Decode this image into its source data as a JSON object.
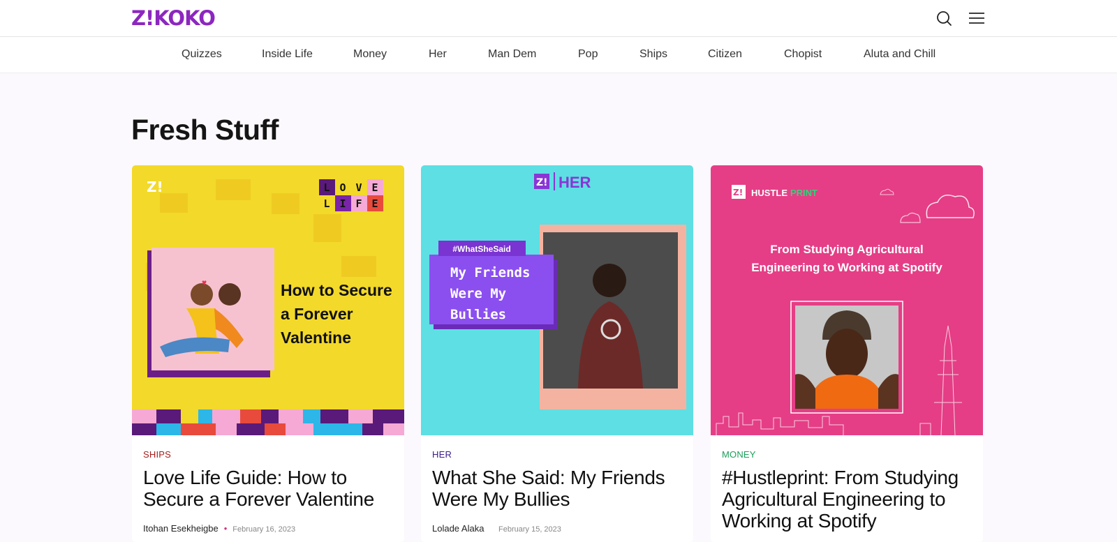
{
  "brand": {
    "logo": "Z!KOKO"
  },
  "header": {
    "search_icon": "search-icon",
    "menu_icon": "hamburger-menu-icon"
  },
  "nav": {
    "items": [
      {
        "label": "Quizzes"
      },
      {
        "label": "Inside Life"
      },
      {
        "label": "Money"
      },
      {
        "label": "Her"
      },
      {
        "label": "Man Dem"
      },
      {
        "label": "Pop"
      },
      {
        "label": "Ships"
      },
      {
        "label": "Citizen"
      },
      {
        "label": "Chopist"
      },
      {
        "label": "Aluta and Chill"
      }
    ]
  },
  "section": {
    "title": "Fresh Stuff"
  },
  "cards": [
    {
      "category": "Ships",
      "category_color": "#a51e1e",
      "title": "Love Life Guide: How to Secure a Forever Valentine",
      "author": "Itohan Esekheigbe",
      "date": "February 16, 2023",
      "image": {
        "badge": "Z!",
        "tiles": [
          "L",
          "O",
          "V",
          "E",
          "L",
          "I",
          "F",
          "E"
        ],
        "headline_lines": [
          "How to Secure",
          "a Forever",
          "Valentine"
        ]
      }
    },
    {
      "category": "Her",
      "category_color": "#3a1a8a",
      "title": "What She Said: My Friends Were My Bullies",
      "author": "Lolade Alaka",
      "date": "February 15, 2023",
      "image": {
        "badge": "Z!",
        "brand": "HER",
        "tag": "#WhatSheSaid",
        "text_lines": [
          "My Friends",
          "Were My",
          "Bullies"
        ]
      }
    },
    {
      "category": "Money",
      "category_color": "#1b9e5a",
      "title": "#Hustleprint: From Studying Agricultural Engineering to Working at Spotify",
      "author": "",
      "date": "",
      "image": {
        "badge": "Z!",
        "brand_a": "HUSTLE",
        "brand_b": "PRINT",
        "headline_lines": [
          "From Studying Agricultural",
          "Engineering to Working at Spotify"
        ]
      }
    }
  ]
}
